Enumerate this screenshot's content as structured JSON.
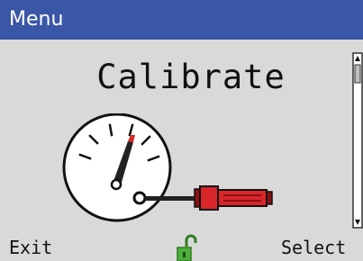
{
  "window": {
    "title": "Menu"
  },
  "main": {
    "heading": "Calibrate",
    "illustration_icon": "gauge-with-screwdriver"
  },
  "softkeys": {
    "left_label": "Exit",
    "right_label": "Select"
  },
  "status": {
    "lock_icon": "unlocked-padlock",
    "lock_state": "unlocked"
  },
  "colors": {
    "title_bar": "#3a56a7",
    "background": "#d9d9d9",
    "screwdriver_handle": "#d8262b",
    "needle_tip": "#d8262b",
    "lock": "#4caf3a"
  }
}
